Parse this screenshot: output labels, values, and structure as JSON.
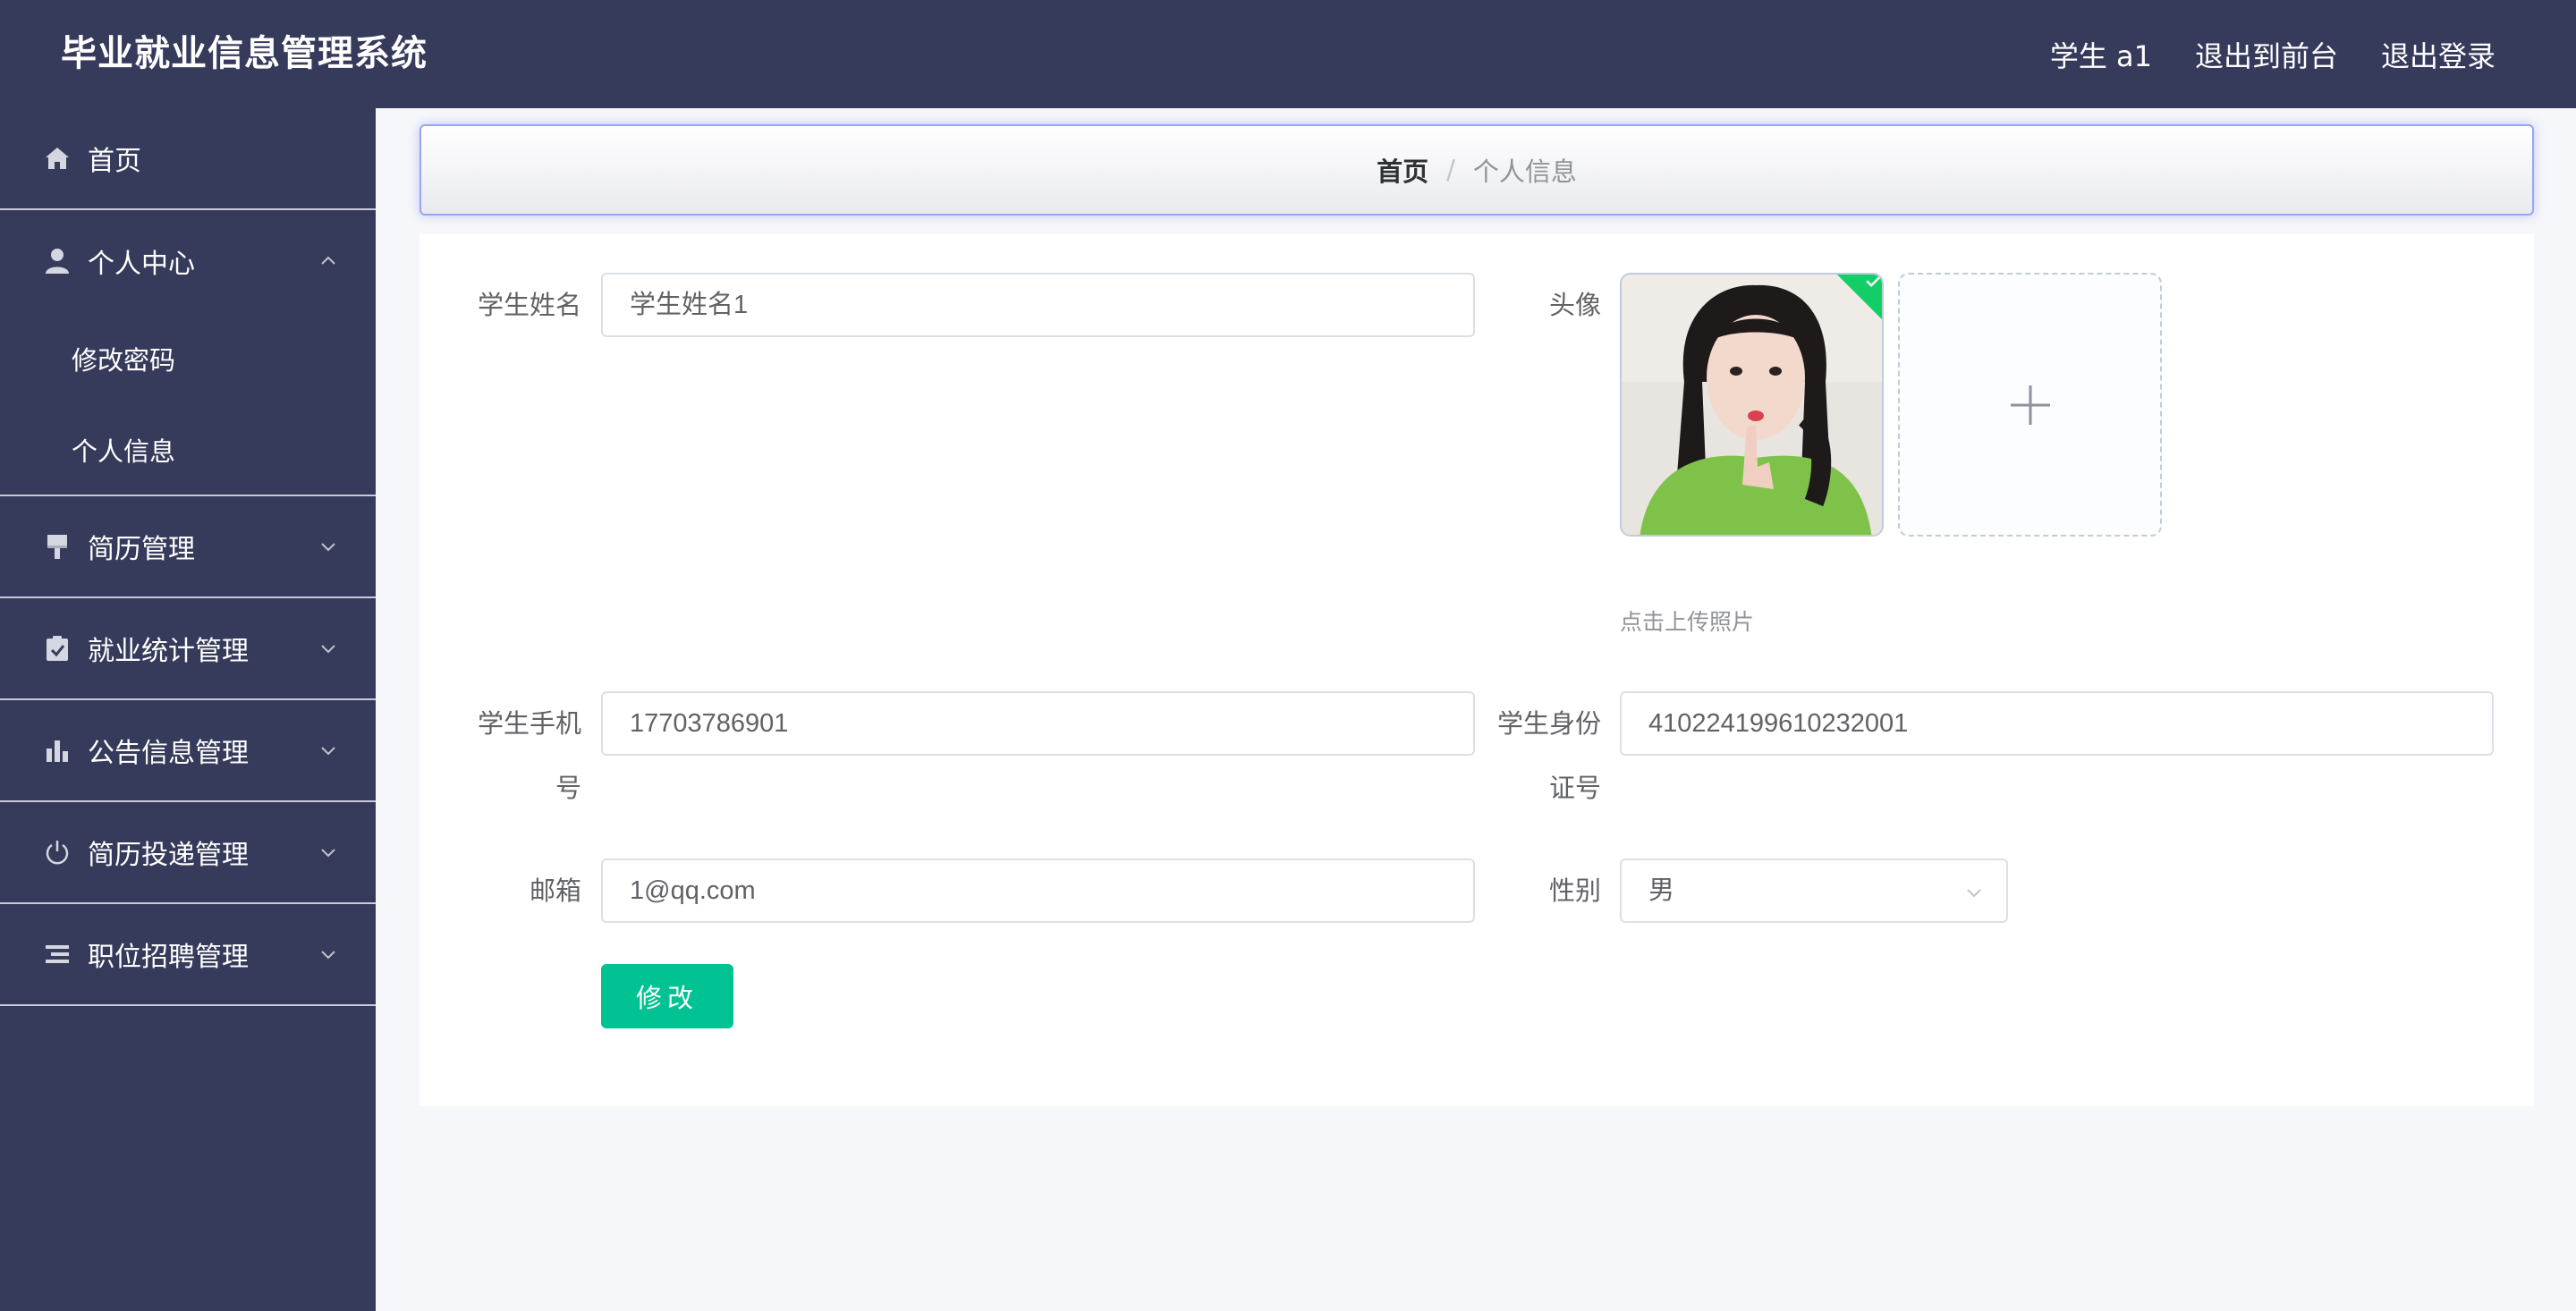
{
  "header": {
    "title": "毕业就业信息管理系统",
    "user": "学生 a1",
    "to_front": "退出到前台",
    "logout": "退出登录"
  },
  "sidebar": {
    "items": [
      {
        "label": "首页",
        "icon": "home-icon"
      },
      {
        "label": "个人中心",
        "icon": "user-icon",
        "expanded": true,
        "children": [
          "修改密码",
          "个人信息"
        ]
      },
      {
        "label": "简历管理",
        "icon": "brush-icon"
      },
      {
        "label": "就业统计管理",
        "icon": "clipboard-check-icon"
      },
      {
        "label": "公告信息管理",
        "icon": "bar-chart-icon"
      },
      {
        "label": "简历投递管理",
        "icon": "power-icon"
      },
      {
        "label": "职位招聘管理",
        "icon": "list-icon"
      }
    ]
  },
  "breadcrumb": {
    "home": "首页",
    "separator": "/",
    "current": "个人信息"
  },
  "form": {
    "name_label": "学生姓名",
    "name_value": "学生姓名1",
    "avatar_label": "头像",
    "avatar_tip": "点击上传照片",
    "phone_label_line1": "学生手机",
    "phone_label_line2": "号",
    "phone_value": "17703786901",
    "idcard_label_line1": "学生身份",
    "idcard_label_line2": "证号",
    "idcard_value": "410224199610232001",
    "email_label": "邮箱",
    "email_value": "1@qq.com",
    "gender_label": "性别",
    "gender_value": "男",
    "submit_label": "修改"
  },
  "colors": {
    "sidebar_bg": "#363a5b",
    "accent": "#00c292",
    "upload_success": "#13ce66"
  }
}
